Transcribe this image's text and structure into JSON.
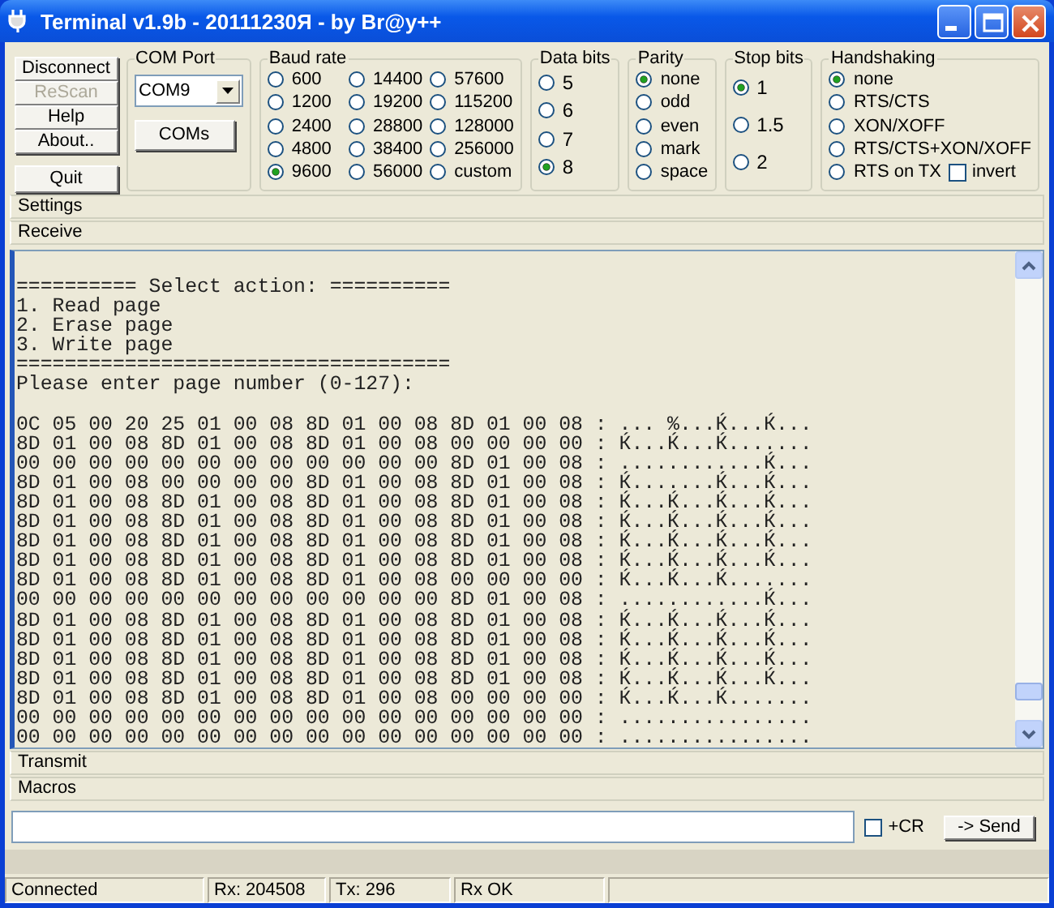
{
  "window": {
    "title": "Terminal v1.9b - 20111230Я - by Br@y++"
  },
  "buttons": [
    {
      "label": "Disconnect",
      "disabled": false
    },
    {
      "label": "ReScan",
      "disabled": true
    },
    {
      "label": "Help",
      "disabled": false
    },
    {
      "label": "About..",
      "disabled": false
    },
    {
      "label": "Quit",
      "disabled": false
    }
  ],
  "com_port": {
    "title": "COM Port",
    "value": "COM9",
    "button": "COMs"
  },
  "baud_rate": {
    "title": "Baud rate",
    "options": [
      {
        "label": "600",
        "selected": false
      },
      {
        "label": "1200",
        "selected": false
      },
      {
        "label": "2400",
        "selected": false
      },
      {
        "label": "4800",
        "selected": false
      },
      {
        "label": "9600",
        "selected": true
      },
      {
        "label": "14400",
        "selected": false
      },
      {
        "label": "19200",
        "selected": false
      },
      {
        "label": "28800",
        "selected": false
      },
      {
        "label": "38400",
        "selected": false
      },
      {
        "label": "56000",
        "selected": false
      },
      {
        "label": "57600",
        "selected": false
      },
      {
        "label": "115200",
        "selected": false
      },
      {
        "label": "128000",
        "selected": false
      },
      {
        "label": "256000",
        "selected": false
      },
      {
        "label": "custom",
        "selected": false
      }
    ]
  },
  "data_bits": {
    "title": "Data bits",
    "options": [
      {
        "label": "5",
        "selected": false
      },
      {
        "label": "6",
        "selected": false
      },
      {
        "label": "7",
        "selected": false
      },
      {
        "label": "8",
        "selected": true
      }
    ]
  },
  "parity": {
    "title": "Parity",
    "options": [
      {
        "label": "none",
        "selected": true
      },
      {
        "label": "odd",
        "selected": false
      },
      {
        "label": "even",
        "selected": false
      },
      {
        "label": "mark",
        "selected": false
      },
      {
        "label": "space",
        "selected": false
      }
    ]
  },
  "stop_bits": {
    "title": "Stop bits",
    "options": [
      {
        "label": "1",
        "selected": true
      },
      {
        "label": "1.5",
        "selected": false
      },
      {
        "label": "2",
        "selected": false
      }
    ]
  },
  "handshaking": {
    "title": "Handshaking",
    "options": [
      {
        "label": "none",
        "selected": true
      },
      {
        "label": "RTS/CTS",
        "selected": false
      },
      {
        "label": "XON/XOFF",
        "selected": false
      },
      {
        "label": "RTS/CTS+XON/XOFF",
        "selected": false
      },
      {
        "label": "RTS on TX",
        "selected": false
      }
    ],
    "invert": {
      "label": "invert",
      "checked": false
    }
  },
  "sections": {
    "settings": "Settings",
    "receive": "Receive",
    "transmit": "Transmit",
    "macros": "Macros"
  },
  "receive": {
    "menu_lines": [
      "========== Select action: ==========",
      "1. Read page",
      "2. Erase page",
      "3. Write page",
      "====================================",
      "Please enter page number (0-127):"
    ],
    "dump_lines": [
      "0C 05 00 20 25 01 00 08 8D 01 00 08 8D 01 00 08 : ... %...Ќ...Ќ...",
      "8D 01 00 08 8D 01 00 08 8D 01 00 08 00 00 00 00 : Ќ...Ќ...Ќ.......",
      "00 00 00 00 00 00 00 00 00 00 00 00 8D 01 00 08 : ............Ќ...",
      "8D 01 00 08 00 00 00 00 8D 01 00 08 8D 01 00 08 : Ќ.......Ќ...Ќ...",
      "8D 01 00 08 8D 01 00 08 8D 01 00 08 8D 01 00 08 : Ќ...Ќ...Ќ...Ќ...",
      "8D 01 00 08 8D 01 00 08 8D 01 00 08 8D 01 00 08 : Ќ...Ќ...Ќ...Ќ...",
      "8D 01 00 08 8D 01 00 08 8D 01 00 08 8D 01 00 08 : Ќ...Ќ...Ќ...Ќ...",
      "8D 01 00 08 8D 01 00 08 8D 01 00 08 8D 01 00 08 : Ќ...Ќ...Ќ...Ќ...",
      "8D 01 00 08 8D 01 00 08 8D 01 00 08 00 00 00 00 : Ќ...Ќ...Ќ.......",
      "00 00 00 00 00 00 00 00 00 00 00 00 8D 01 00 08 : ............Ќ...",
      "8D 01 00 08 8D 01 00 08 8D 01 00 08 8D 01 00 08 : Ќ...Ќ...Ќ...Ќ...",
      "8D 01 00 08 8D 01 00 08 8D 01 00 08 8D 01 00 08 : Ќ...Ќ...Ќ...Ќ...",
      "8D 01 00 08 8D 01 00 08 8D 01 00 08 8D 01 00 08 : Ќ...Ќ...Ќ...Ќ...",
      "8D 01 00 08 8D 01 00 08 8D 01 00 08 8D 01 00 08 : Ќ...Ќ...Ќ...Ќ...",
      "8D 01 00 08 8D 01 00 08 8D 01 00 08 00 00 00 00 : Ќ...Ќ...Ќ.......",
      "00 00 00 00 00 00 00 00 00 00 00 00 00 00 00 00 : ................",
      "00 00 00 00 00 00 00 00 00 00 00 00 00 00 00 00 : ................"
    ]
  },
  "send_row": {
    "cr": {
      "label": "+CR",
      "checked": false
    },
    "button": "-> Send"
  },
  "status_bar": [
    "Connected",
    "Rx: 204508",
    "Tx: 296",
    "Rx OK"
  ]
}
